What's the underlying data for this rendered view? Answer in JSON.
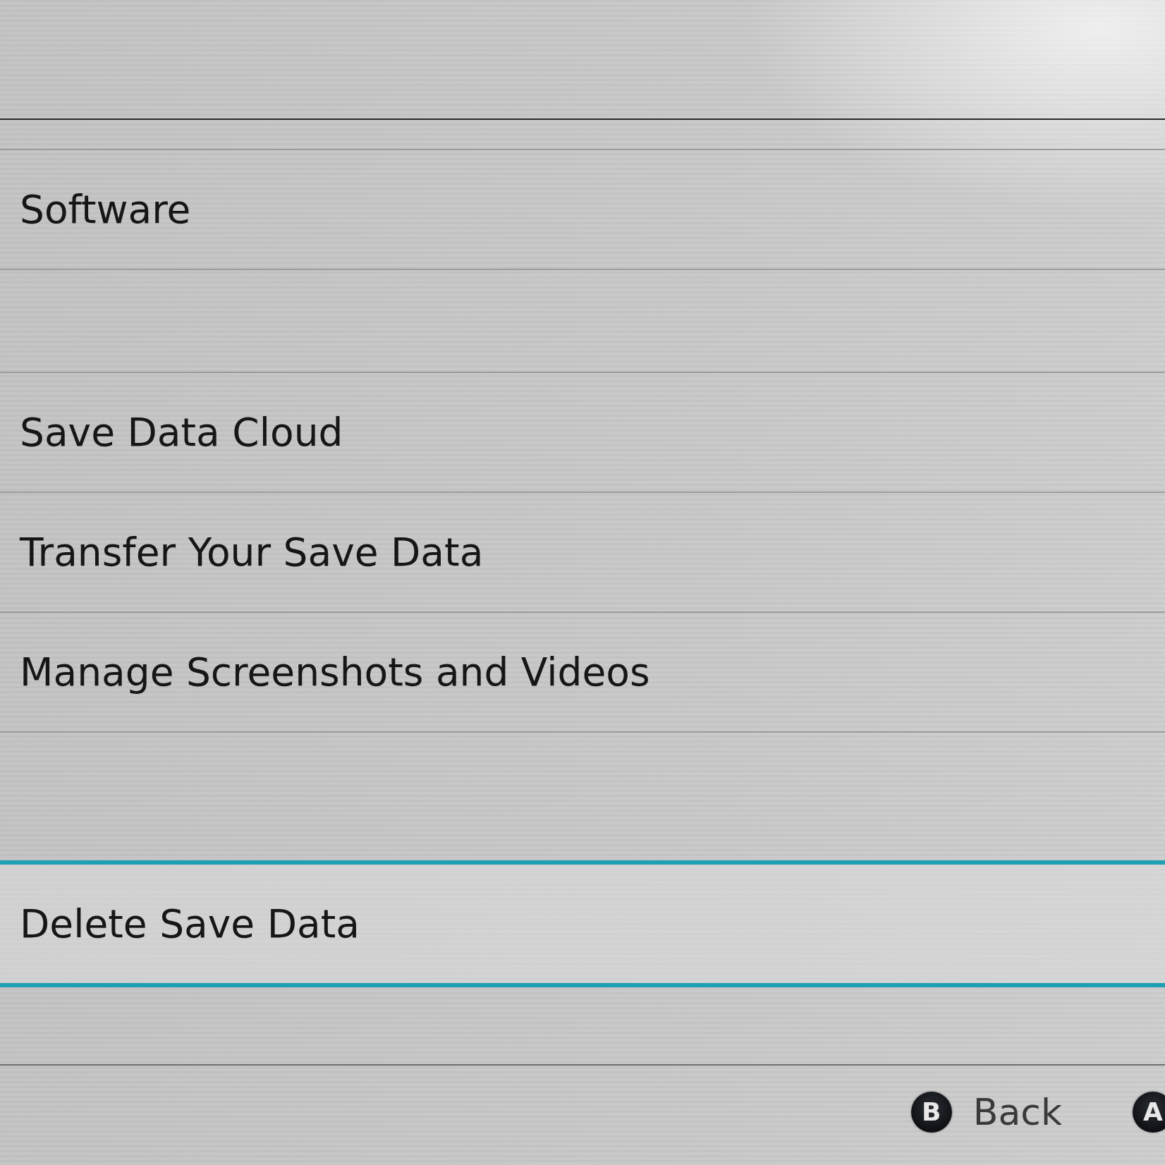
{
  "list": {
    "items": [
      {
        "kind": "entry",
        "label": "Software",
        "selected": false
      },
      {
        "kind": "blank"
      },
      {
        "kind": "entry",
        "label": "Save Data Cloud",
        "selected": false
      },
      {
        "kind": "entry",
        "label": "Transfer Your Save Data",
        "selected": false
      },
      {
        "kind": "entry",
        "label": "Manage Screenshots and Videos",
        "selected": false
      },
      {
        "kind": "blank"
      },
      {
        "kind": "entry",
        "label": "Delete Save Data",
        "selected": true
      }
    ]
  },
  "footer": {
    "buttons": [
      {
        "key": "B",
        "label": "Back"
      },
      {
        "key": "A"
      }
    ]
  }
}
